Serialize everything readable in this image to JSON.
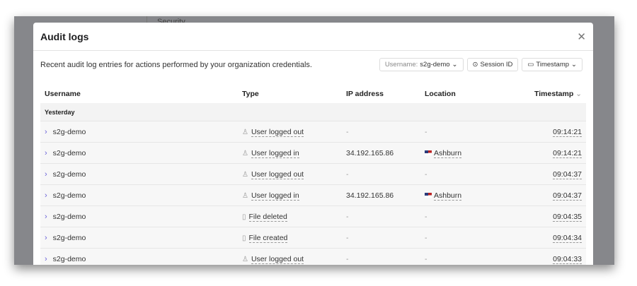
{
  "background": {
    "nav_item": "Security"
  },
  "dialog": {
    "title": "Audit logs",
    "close_icon": "close-icon",
    "description": "Recent audit log entries for actions performed by your organization credentials.",
    "filters": {
      "username_label": "Username:",
      "username_value": "s2g-demo",
      "session_id": "Session ID",
      "timestamp": "Timestamp"
    },
    "columns": [
      "Username",
      "Type",
      "IP address",
      "Location",
      "Timestamp"
    ],
    "group_label": "Yesterday",
    "rows": [
      {
        "username": "s2g-demo",
        "icon": "user-icon",
        "type": "User logged out",
        "ip": "-",
        "location": "-",
        "flag": false,
        "time": "09:14:21"
      },
      {
        "username": "s2g-demo",
        "icon": "user-icon",
        "type": "User logged in",
        "ip": "34.192.165.86",
        "location": "Ashburn",
        "flag": true,
        "time": "09:14:21"
      },
      {
        "username": "s2g-demo",
        "icon": "user-icon",
        "type": "User logged out",
        "ip": "-",
        "location": "-",
        "flag": false,
        "time": "09:04:37"
      },
      {
        "username": "s2g-demo",
        "icon": "user-icon",
        "type": "User logged in",
        "ip": "34.192.165.86",
        "location": "Ashburn",
        "flag": true,
        "time": "09:04:37"
      },
      {
        "username": "s2g-demo",
        "icon": "file-minus-icon",
        "type": "File deleted",
        "ip": "-",
        "location": "-",
        "flag": false,
        "time": "09:04:35"
      },
      {
        "username": "s2g-demo",
        "icon": "file-plus-icon",
        "type": "File created",
        "ip": "-",
        "location": "-",
        "flag": false,
        "time": "09:04:34"
      },
      {
        "username": "s2g-demo",
        "icon": "user-icon",
        "type": "User logged out",
        "ip": "-",
        "location": "-",
        "flag": false,
        "time": "09:04:33"
      }
    ]
  }
}
